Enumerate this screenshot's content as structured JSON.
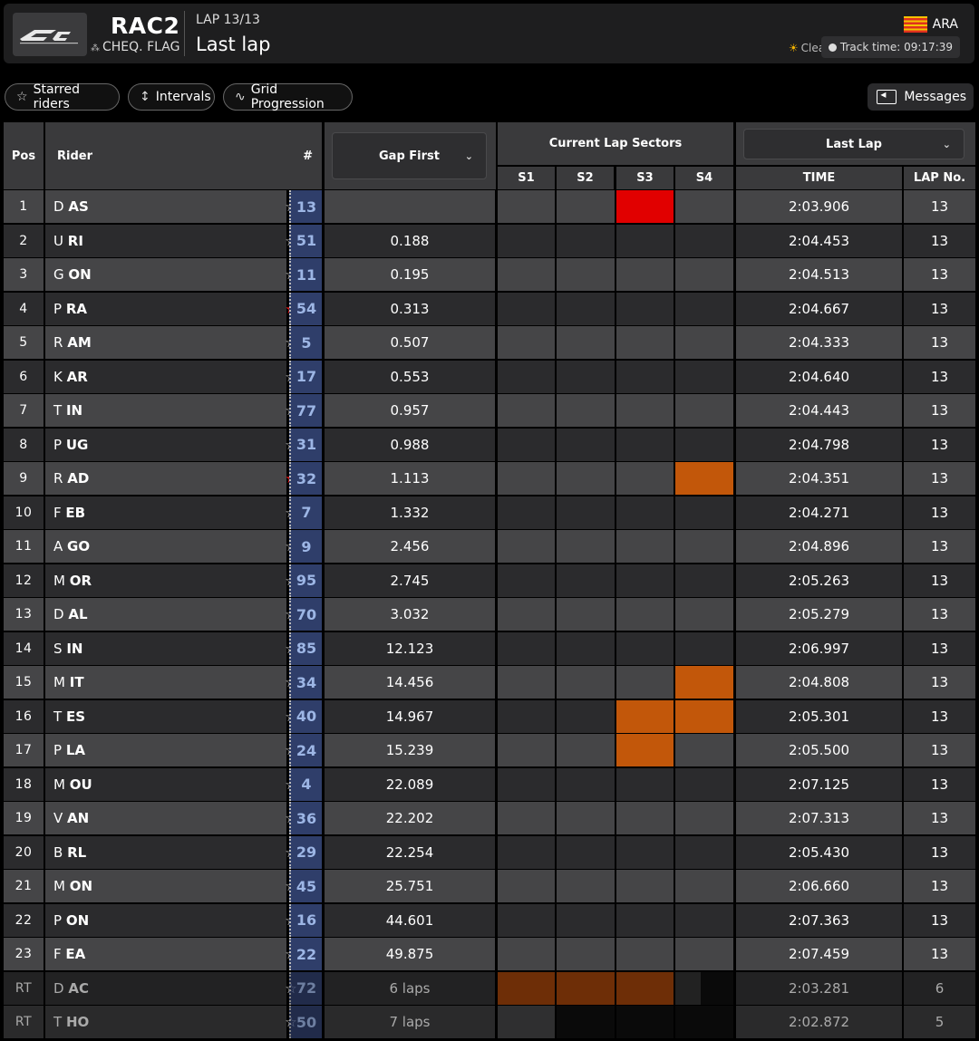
{
  "header": {
    "session": "RAC2",
    "flag_status": "CHEQ. FLAG",
    "lap_label": "LAP 13/13",
    "lap_title": "Last lap",
    "circuit_code": "ARA",
    "weather": "Clear",
    "track_time": "Track time: 09:17:39"
  },
  "toolbar": {
    "starred_label": "Starred riders",
    "intervals_label": "Intervals",
    "grid_label": "Grid Progression",
    "messages_label": "Messages"
  },
  "columns": {
    "pos": "Pos",
    "rider": "Rider",
    "number": "#",
    "gap_select": "Gap First",
    "sectors_title": "Current Lap Sectors",
    "s1": "S1",
    "s2": "S2",
    "s3": "S3",
    "s4": "S4",
    "last_select": "Last Lap",
    "time": "TIME",
    "lapno": "LAP No."
  },
  "colors": {
    "row_light": "#454547",
    "row_dark": "#2b2b2d",
    "sector_best": "#e10000",
    "sector_personal": "#c2570a",
    "sector_retired": "#6e2e07",
    "number_bg": "#2f3e6a"
  },
  "rows": [
    {
      "pos": "1",
      "first": "D",
      "last": "AS",
      "starred": false,
      "num": "13",
      "gap": "",
      "sectors": [
        "",
        "",
        "best",
        ""
      ],
      "time": "2:03.906",
      "lapno": "13"
    },
    {
      "pos": "2",
      "first": "U",
      "last": "RI",
      "starred": false,
      "num": "51",
      "gap": "0.188",
      "sectors": [
        "",
        "",
        "",
        ""
      ],
      "time": "2:04.453",
      "lapno": "13"
    },
    {
      "pos": "3",
      "first": "G",
      "last": "ON",
      "starred": false,
      "num": "11",
      "gap": "0.195",
      "sectors": [
        "",
        "",
        "",
        ""
      ],
      "time": "2:04.513",
      "lapno": "13"
    },
    {
      "pos": "4",
      "first": "P",
      "last": "RA",
      "starred": true,
      "num": "54",
      "gap": "0.313",
      "sectors": [
        "",
        "",
        "",
        ""
      ],
      "time": "2:04.667",
      "lapno": "13"
    },
    {
      "pos": "5",
      "first": "R",
      "last": "AM",
      "starred": false,
      "num": "5",
      "gap": "0.507",
      "sectors": [
        "",
        "",
        "",
        ""
      ],
      "time": "2:04.333",
      "lapno": "13"
    },
    {
      "pos": "6",
      "first": "K",
      "last": "AR",
      "starred": false,
      "num": "17",
      "gap": "0.553",
      "sectors": [
        "",
        "",
        "",
        ""
      ],
      "time": "2:04.640",
      "lapno": "13"
    },
    {
      "pos": "7",
      "first": "T",
      "last": "IN",
      "starred": false,
      "num": "77",
      "gap": "0.957",
      "sectors": [
        "",
        "",
        "",
        ""
      ],
      "time": "2:04.443",
      "lapno": "13"
    },
    {
      "pos": "8",
      "first": "P",
      "last": "UG",
      "starred": false,
      "num": "31",
      "gap": "0.988",
      "sectors": [
        "",
        "",
        "",
        ""
      ],
      "time": "2:04.798",
      "lapno": "13"
    },
    {
      "pos": "9",
      "first": "R",
      "last": "AD",
      "starred": true,
      "num": "32",
      "gap": "1.113",
      "sectors": [
        "",
        "",
        "",
        "personal"
      ],
      "time": "2:04.351",
      "lapno": "13"
    },
    {
      "pos": "10",
      "first": "F",
      "last": "EB",
      "starred": false,
      "num": "7",
      "gap": "1.332",
      "sectors": [
        "",
        "",
        "",
        ""
      ],
      "time": "2:04.271",
      "lapno": "13"
    },
    {
      "pos": "11",
      "first": "A",
      "last": "GO",
      "starred": false,
      "num": "9",
      "gap": "2.456",
      "sectors": [
        "",
        "",
        "",
        ""
      ],
      "time": "2:04.896",
      "lapno": "13"
    },
    {
      "pos": "12",
      "first": "M",
      "last": "OR",
      "starred": false,
      "num": "95",
      "gap": "2.745",
      "sectors": [
        "",
        "",
        "",
        ""
      ],
      "time": "2:05.263",
      "lapno": "13"
    },
    {
      "pos": "13",
      "first": "D",
      "last": "AL",
      "starred": false,
      "num": "70",
      "gap": "3.032",
      "sectors": [
        "",
        "",
        "",
        ""
      ],
      "time": "2:05.279",
      "lapno": "13"
    },
    {
      "pos": "14",
      "first": "S",
      "last": "IN",
      "starred": false,
      "num": "85",
      "gap": "12.123",
      "sectors": [
        "",
        "",
        "",
        ""
      ],
      "time": "2:06.997",
      "lapno": "13"
    },
    {
      "pos": "15",
      "first": "M",
      "last": "IT",
      "starred": false,
      "num": "34",
      "gap": "14.456",
      "sectors": [
        "",
        "",
        "",
        "personal"
      ],
      "time": "2:04.808",
      "lapno": "13"
    },
    {
      "pos": "16",
      "first": "T",
      "last": "ES",
      "starred": false,
      "num": "40",
      "gap": "14.967",
      "sectors": [
        "",
        "",
        "personal",
        "personal"
      ],
      "time": "2:05.301",
      "lapno": "13"
    },
    {
      "pos": "17",
      "first": "P",
      "last": "LA",
      "starred": false,
      "num": "24",
      "gap": "15.239",
      "sectors": [
        "",
        "",
        "personal",
        ""
      ],
      "time": "2:05.500",
      "lapno": "13"
    },
    {
      "pos": "18",
      "first": "M",
      "last": "OU",
      "starred": false,
      "num": "4",
      "gap": "22.089",
      "sectors": [
        "",
        "",
        "",
        ""
      ],
      "time": "2:07.125",
      "lapno": "13"
    },
    {
      "pos": "19",
      "first": "V",
      "last": "AN",
      "starred": false,
      "num": "36",
      "gap": "22.202",
      "sectors": [
        "",
        "",
        "",
        ""
      ],
      "time": "2:07.313",
      "lapno": "13"
    },
    {
      "pos": "20",
      "first": "B",
      "last": "RL",
      "starred": false,
      "num": "29",
      "gap": "22.254",
      "sectors": [
        "",
        "",
        "",
        ""
      ],
      "time": "2:05.430",
      "lapno": "13"
    },
    {
      "pos": "21",
      "first": "M",
      "last": "ON",
      "starred": false,
      "num": "45",
      "gap": "25.751",
      "sectors": [
        "",
        "",
        "",
        ""
      ],
      "time": "2:06.660",
      "lapno": "13"
    },
    {
      "pos": "22",
      "first": "P",
      "last": "ON",
      "starred": false,
      "num": "16",
      "gap": "44.601",
      "sectors": [
        "",
        "",
        "",
        ""
      ],
      "time": "2:07.363",
      "lapno": "13"
    },
    {
      "pos": "23",
      "first": "F",
      "last": "EA",
      "starred": false,
      "num": "22",
      "gap": "49.875",
      "sectors": [
        "",
        "",
        "",
        ""
      ],
      "time": "2:07.459",
      "lapno": "13"
    },
    {
      "pos": "RT",
      "first": "D",
      "last": "AC",
      "starred": false,
      "num": "72",
      "gap": "6 laps",
      "sectors": [
        "retired",
        "retired",
        "retired",
        "partial"
      ],
      "time": "2:03.281",
      "lapno": "6",
      "retired": true
    },
    {
      "pos": "RT",
      "first": "T",
      "last": "HO",
      "starred": false,
      "num": "50",
      "gap": "7 laps",
      "sectors": [
        "grey",
        "black",
        "black",
        "black"
      ],
      "time": "2:02.872",
      "lapno": "5",
      "retired": true
    }
  ]
}
